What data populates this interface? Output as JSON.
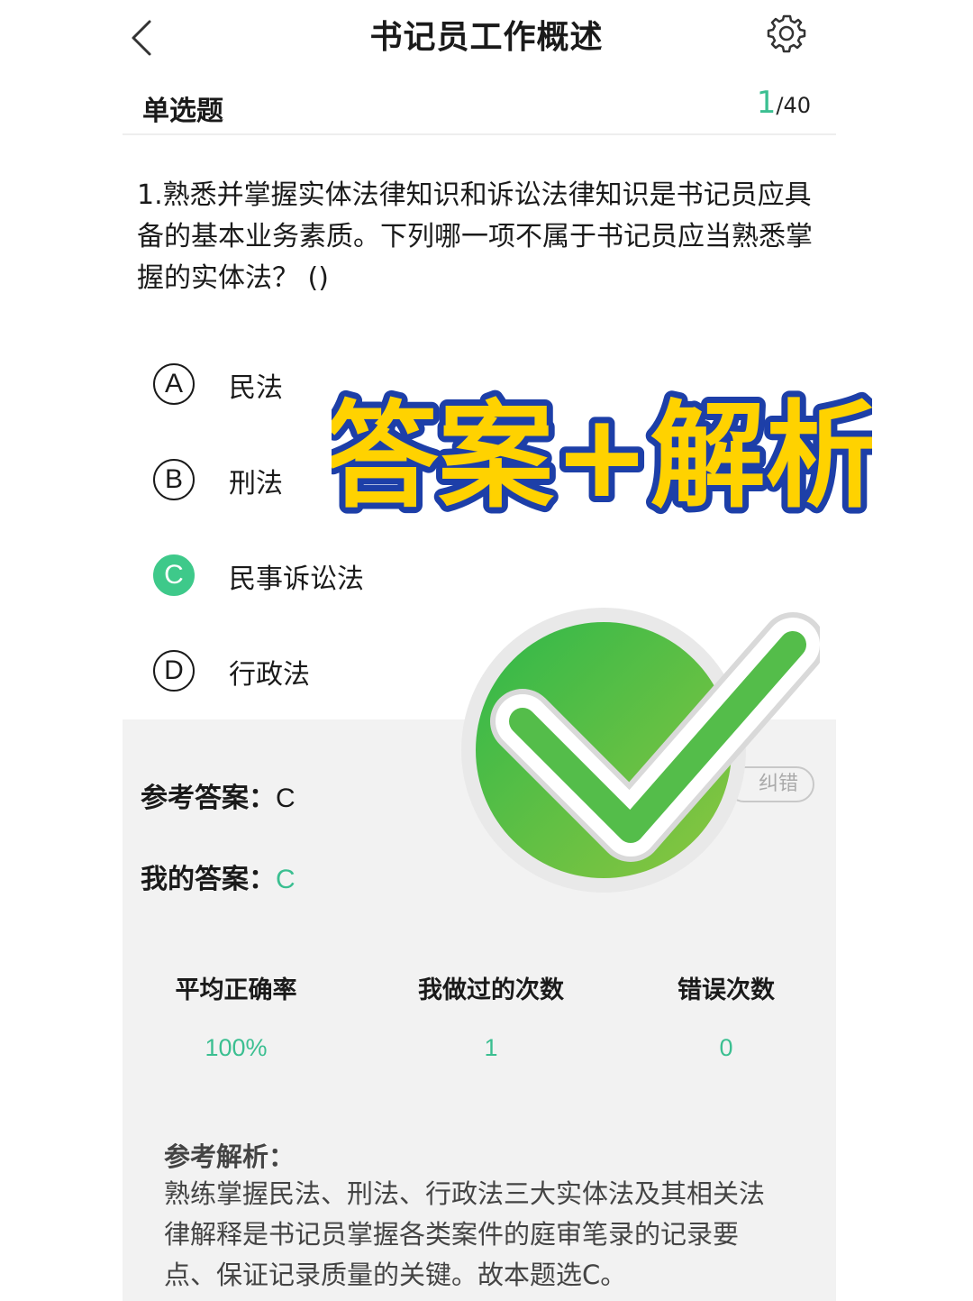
{
  "header": {
    "title": "书记员工作概述",
    "back_icon": "chevron-left-icon",
    "settings_icon": "gear-icon"
  },
  "subheader": {
    "question_type": "单选题",
    "current": "1",
    "total": "/40"
  },
  "question": {
    "text": "1.熟悉并掌握实体法律知识和诉讼法律知识是书记员应具备的基本业务素质。下列哪一项不属于书记员应当熟悉掌握的实体法？ ()"
  },
  "options": [
    {
      "letter": "A",
      "text": "民法",
      "selected": false
    },
    {
      "letter": "B",
      "text": "刑法",
      "selected": false
    },
    {
      "letter": "C",
      "text": "民事诉讼法",
      "selected": true
    },
    {
      "letter": "D",
      "text": "行政法",
      "selected": false
    }
  ],
  "answers": {
    "reference_label": "参考答案：",
    "reference_value": "C",
    "mine_label": "我的答案：",
    "mine_value": "C",
    "report_button": "纠错"
  },
  "stats": [
    {
      "label": "平均正确率",
      "value": "100%"
    },
    {
      "label": "我做过的次数",
      "value": "1"
    },
    {
      "label": "错误次数",
      "value": "0"
    }
  ],
  "analysis": {
    "title": "参考解析：",
    "text": "熟练掌握民法、刑法、行政法三大实体法及其相关法律解释是书记员掌握各类案件的庭审笔录的记录要点、保证记录质量的关键。故本题选C。"
  },
  "overlay": {
    "banner_text": "答案+解析",
    "banner_fill": "#ffd200",
    "banner_stroke": "#1d3fa8",
    "check_color": "#3dbb4e"
  }
}
